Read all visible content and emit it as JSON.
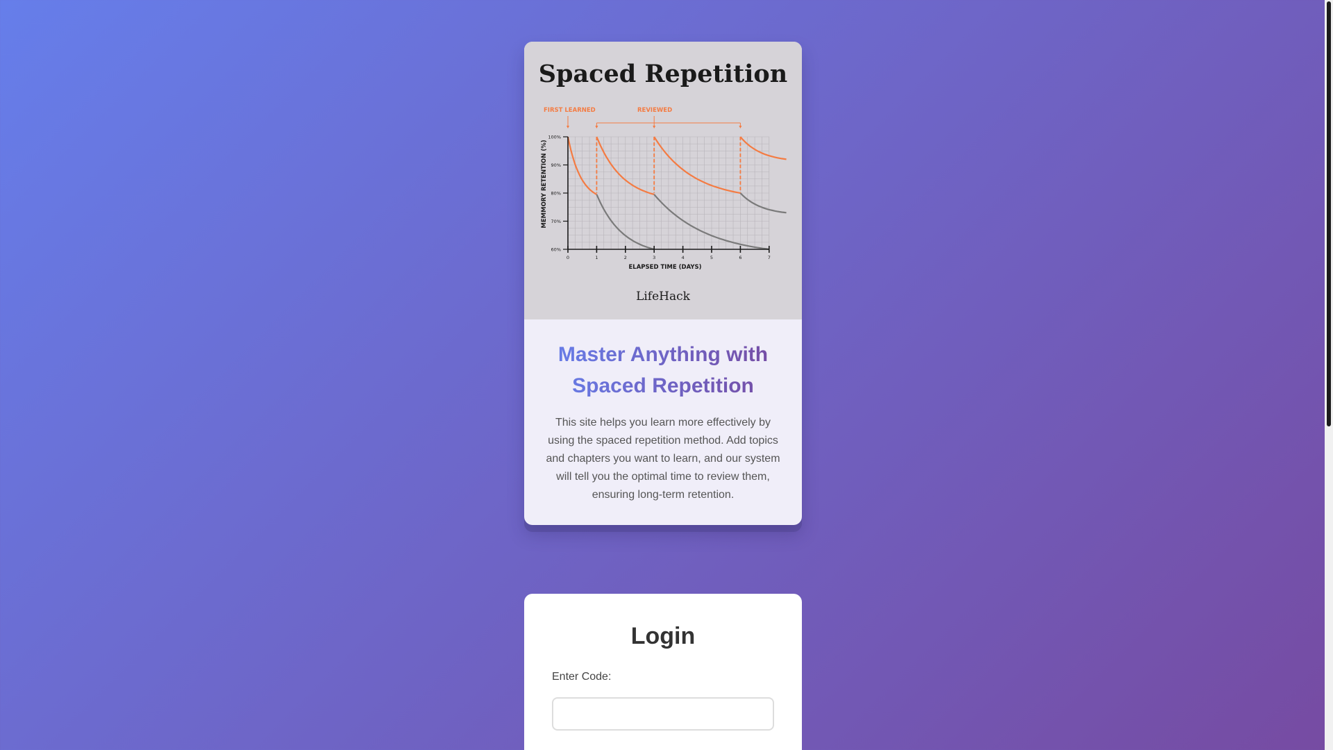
{
  "info_card": {
    "image": {
      "title": "Spaced Repetition",
      "first_learned_label": "FIRST LEARNED",
      "reviewed_label": "REVIEWED",
      "y_axis_label": "MEMMORY RETENTION (%)",
      "x_axis_label": "ELAPSED TIME (DAYS)",
      "y_ticks": [
        "100%",
        "90%",
        "80%",
        "70%",
        "60%"
      ],
      "x_ticks": [
        "0",
        "1",
        "2",
        "3",
        "4",
        "5",
        "6",
        "7"
      ],
      "brand": "LifeHack",
      "colors": {
        "accent": "#f47b42",
        "decay": "#7a7a7a"
      }
    },
    "heading": "Master Anything with Spaced Repetition",
    "description": "This site helps you learn more effectively by using the spaced repetition method. Add topics and chapters you want to learn, and our system will tell you the optimal time to review them, ensuring long-term retention."
  },
  "login": {
    "title": "Login",
    "code_label": "Enter Code:",
    "code_value": "",
    "code_placeholder": ""
  },
  "theme": {
    "gradient_start": "#667eea",
    "gradient_end": "#764ba2"
  }
}
